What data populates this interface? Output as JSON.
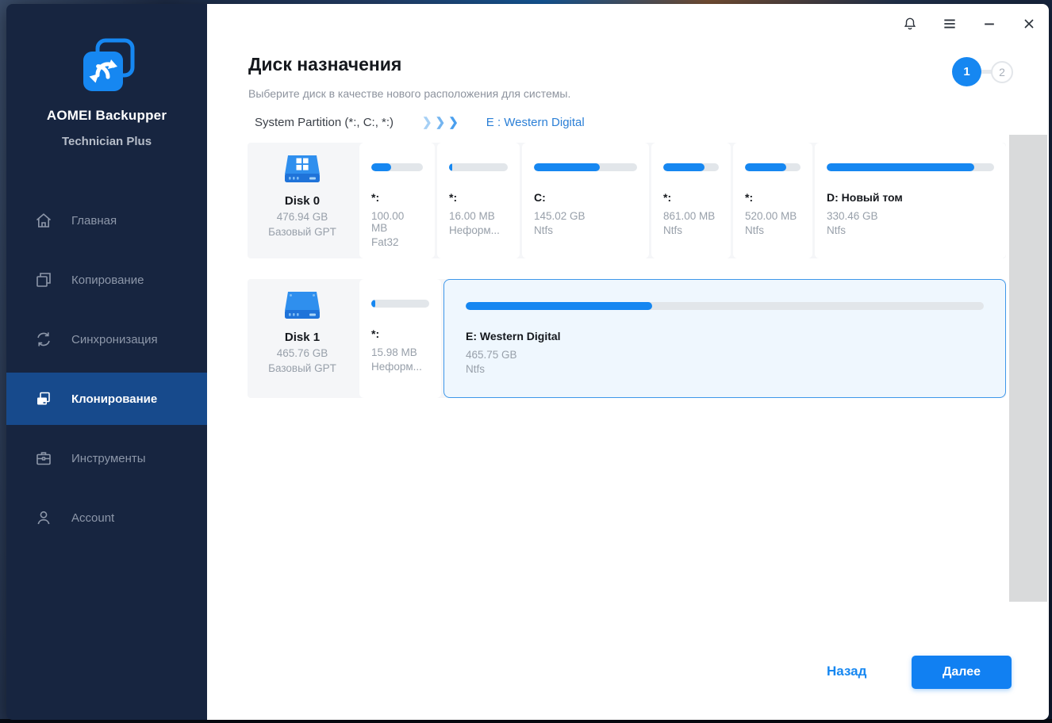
{
  "colors": {
    "accent": "#1687f1",
    "sidebar_bg": "#172540",
    "active_item_bg": "#174a8c",
    "selected_card_border": "#3e97ea",
    "selected_card_bg": "#eff7fe",
    "bar_track": "#e2e6ea",
    "breadcrumb_link": "#2b7fd6"
  },
  "sidebar": {
    "app_name": "AOMEI Backupper",
    "edition": "Technician Plus",
    "items": [
      {
        "id": "home",
        "label": "Главная",
        "icon": "home-icon",
        "active": false
      },
      {
        "id": "backup",
        "label": "Копирование",
        "icon": "copy-icon",
        "active": false
      },
      {
        "id": "sync",
        "label": "Синхронизация",
        "icon": "sync-icon",
        "active": false
      },
      {
        "id": "clone",
        "label": "Клонирование",
        "icon": "clone-icon",
        "active": true
      },
      {
        "id": "tools",
        "label": "Инструменты",
        "icon": "briefcase-icon",
        "active": false
      },
      {
        "id": "account",
        "label": "Account",
        "icon": "person-icon",
        "active": false
      }
    ]
  },
  "titlebar": {
    "icons": [
      "bell-icon",
      "menu-icon",
      "minimize-icon",
      "close-icon"
    ]
  },
  "header": {
    "title": "Диск назначения",
    "subtitle": "Выберите диск в качестве нового расположения для системы.",
    "breadcrumb_source": "System Partition (*:, C:, *:)",
    "breadcrumb_chevrons": "❯❯❯",
    "breadcrumb_target": "E : Western Digital"
  },
  "steps": {
    "current": "1",
    "next": "2"
  },
  "disks": [
    {
      "name": "Disk 0",
      "size": "476.94 GB",
      "type": "Базовый GPT",
      "icon": "disk-windows-icon",
      "partitions": [
        {
          "label": "*:",
          "size": "100.00 MB",
          "fs": "Fat32",
          "usage_percent": 38,
          "selected": false
        },
        {
          "label": "*:",
          "size": "16.00 MB",
          "fs": "Неформ...",
          "usage_percent": 6,
          "selected": false
        },
        {
          "label": "C:",
          "size": "145.02 GB",
          "fs": "Ntfs",
          "usage_percent": 64,
          "selected": false
        },
        {
          "label": "*:",
          "size": "861.00 MB",
          "fs": "Ntfs",
          "usage_percent": 74,
          "selected": false
        },
        {
          "label": "*:",
          "size": "520.00 MB",
          "fs": "Ntfs",
          "usage_percent": 74,
          "selected": false
        },
        {
          "label": "D: Новый том",
          "size": "330.46 GB",
          "fs": "Ntfs",
          "usage_percent": 88,
          "selected": false
        }
      ]
    },
    {
      "name": "Disk 1",
      "size": "465.76 GB",
      "type": "Базовый GPT",
      "icon": "disk-plain-icon",
      "partitions": [
        {
          "label": "*:",
          "size": "15.98 MB",
          "fs": "Неформ...",
          "usage_percent": 7,
          "selected": false
        },
        {
          "label": "E: Western Digital",
          "size": "465.75 GB",
          "fs": "Ntfs",
          "usage_percent": 36,
          "selected": true
        }
      ]
    }
  ],
  "footer": {
    "back_label": "Назад",
    "next_label": "Далее"
  }
}
